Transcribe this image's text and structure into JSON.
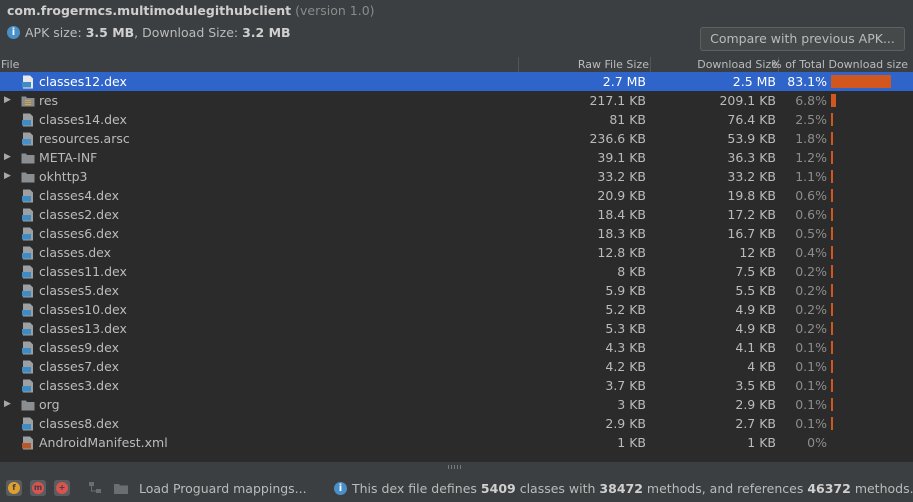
{
  "header": {
    "app_name": "com.frogermcs.multimodulegithubclient",
    "version": "(version 1.0)",
    "apk_size_label": "APK size:",
    "apk_size_value": "3.5 MB",
    "download_size_label": ", Download Size:",
    "download_size_value": "3.2 MB",
    "compare_button": "Compare with previous APK..."
  },
  "table": {
    "columns": {
      "file": "File",
      "raw": "Raw File Size",
      "download": "Download Size",
      "percent": "% of Total Download size"
    },
    "rows": [
      {
        "name": "classes12.dex",
        "raw": "2.7 MB",
        "dl": "2.5 MB",
        "pct": "83.1%",
        "share": 0.831,
        "icon": "dex-file-icon"
      },
      {
        "name": "res",
        "raw": "217.1 KB",
        "dl": "209.1 KB",
        "pct": "6.8%",
        "share": 0.068,
        "icon": "resource-folder-icon",
        "expandable": true
      },
      {
        "name": "classes14.dex",
        "raw": "81 KB",
        "dl": "76.4 KB",
        "pct": "2.5%",
        "share": 0.025,
        "icon": "dex-file-icon"
      },
      {
        "name": "resources.arsc",
        "raw": "236.6 KB",
        "dl": "53.9 KB",
        "pct": "1.8%",
        "share": 0.018,
        "icon": "arsc-file-icon"
      },
      {
        "name": "META-INF",
        "raw": "39.1 KB",
        "dl": "36.3 KB",
        "pct": "1.2%",
        "share": 0.012,
        "icon": "folder-icon",
        "expandable": true
      },
      {
        "name": "okhttp3",
        "raw": "33.2 KB",
        "dl": "33.2 KB",
        "pct": "1.1%",
        "share": 0.011,
        "icon": "folder-icon",
        "expandable": true
      },
      {
        "name": "classes4.dex",
        "raw": "20.9 KB",
        "dl": "19.8 KB",
        "pct": "0.6%",
        "share": 0.006,
        "icon": "dex-file-icon"
      },
      {
        "name": "classes2.dex",
        "raw": "18.4 KB",
        "dl": "17.2 KB",
        "pct": "0.6%",
        "share": 0.006,
        "icon": "dex-file-icon"
      },
      {
        "name": "classes6.dex",
        "raw": "18.3 KB",
        "dl": "16.7 KB",
        "pct": "0.5%",
        "share": 0.005,
        "icon": "dex-file-icon"
      },
      {
        "name": "classes.dex",
        "raw": "12.8 KB",
        "dl": "12 KB",
        "pct": "0.4%",
        "share": 0.004,
        "icon": "dex-file-icon"
      },
      {
        "name": "classes11.dex",
        "raw": "8 KB",
        "dl": "7.5 KB",
        "pct": "0.2%",
        "share": 0.002,
        "icon": "dex-file-icon"
      },
      {
        "name": "classes5.dex",
        "raw": "5.9 KB",
        "dl": "5.5 KB",
        "pct": "0.2%",
        "share": 0.002,
        "icon": "dex-file-icon"
      },
      {
        "name": "classes10.dex",
        "raw": "5.2 KB",
        "dl": "4.9 KB",
        "pct": "0.2%",
        "share": 0.002,
        "icon": "dex-file-icon"
      },
      {
        "name": "classes13.dex",
        "raw": "5.3 KB",
        "dl": "4.9 KB",
        "pct": "0.2%",
        "share": 0.002,
        "icon": "dex-file-icon"
      },
      {
        "name": "classes9.dex",
        "raw": "4.3 KB",
        "dl": "4.1 KB",
        "pct": "0.1%",
        "share": 0.001,
        "icon": "dex-file-icon"
      },
      {
        "name": "classes7.dex",
        "raw": "4.2 KB",
        "dl": "4 KB",
        "pct": "0.1%",
        "share": 0.001,
        "icon": "dex-file-icon"
      },
      {
        "name": "classes3.dex",
        "raw": "3.7 KB",
        "dl": "3.5 KB",
        "pct": "0.1%",
        "share": 0.001,
        "icon": "dex-file-icon"
      },
      {
        "name": "org",
        "raw": "3 KB",
        "dl": "2.9 KB",
        "pct": "0.1%",
        "share": 0.001,
        "icon": "folder-icon",
        "expandable": true
      },
      {
        "name": "classes8.dex",
        "raw": "2.9 KB",
        "dl": "2.7 KB",
        "pct": "0.1%",
        "share": 0.001,
        "icon": "dex-file-icon"
      },
      {
        "name": "AndroidManifest.xml",
        "raw": "1 KB",
        "dl": "1 KB",
        "pct": "0%",
        "share": 0,
        "icon": "manifest-file-icon"
      }
    ],
    "selected_index": 0
  },
  "footer": {
    "load_proguard": "Load Proguard mappings...",
    "status_prefix": "This dex file defines",
    "classes_count": "5409",
    "classes_word": "classes with",
    "methods_count": "38472",
    "methods_word": "methods, and references",
    "ref_count": "46372",
    "ref_word": "methods.",
    "buttons": [
      {
        "icon": "show-fields-icon",
        "glyph": "f",
        "color": "#e0a030"
      },
      {
        "icon": "show-methods-icon",
        "glyph": "m",
        "color": "#d9534f"
      },
      {
        "icon": "show-references-icon",
        "glyph": "+",
        "color": "#d9534f"
      }
    ]
  },
  "colors": {
    "background": "#3c3f41",
    "table_background": "#2b2b2b",
    "selection": "#2f65ca",
    "bar": "#d2571f",
    "info": "#4a90c8"
  }
}
